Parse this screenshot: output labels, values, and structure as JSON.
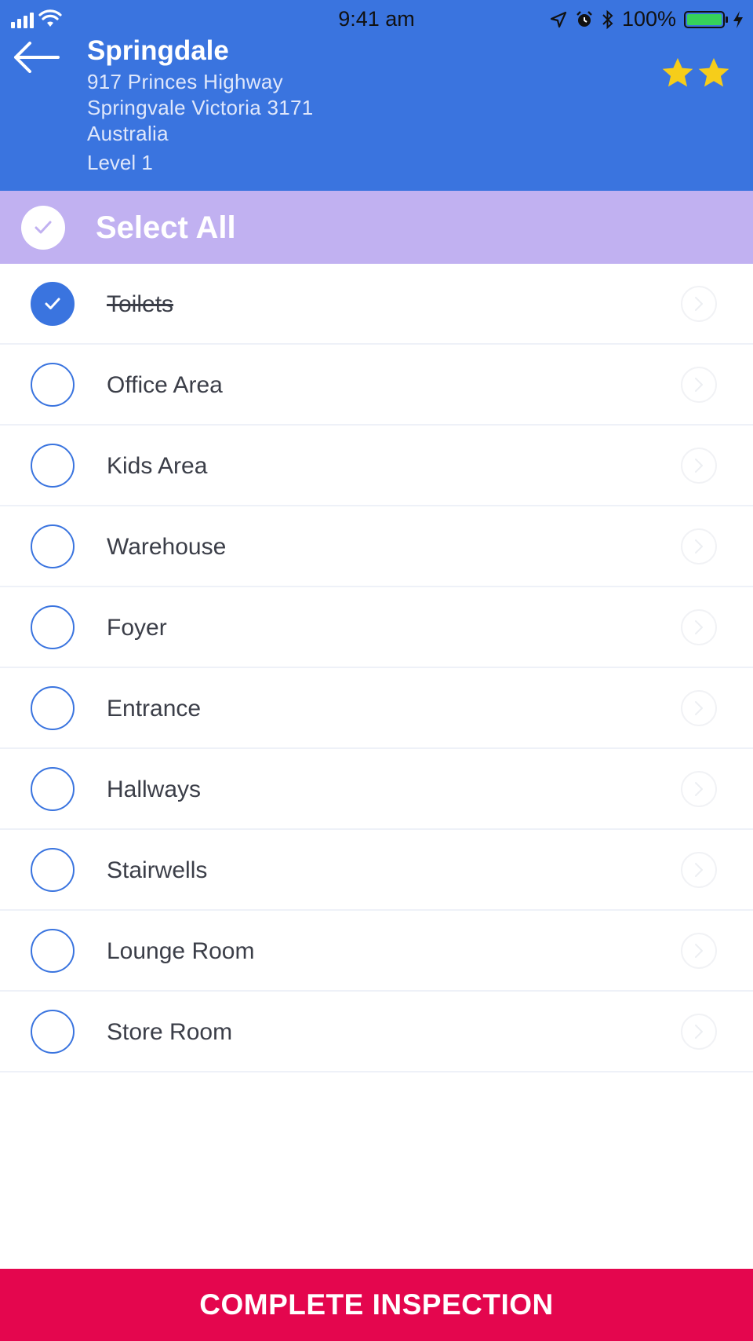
{
  "status_bar": {
    "time": "9:41 am",
    "battery": "100%",
    "icons": [
      "signal-icon",
      "wifi-icon",
      "location-arrow-icon",
      "alarm-icon",
      "bluetooth-icon",
      "battery-icon",
      "charging-bolt-icon"
    ]
  },
  "header": {
    "title": "Springdale",
    "address_line1": "917 Princes Highway",
    "address_line2": "Springvale Victoria 3171",
    "address_line3": "Australia",
    "level": "Level 1",
    "rating_stars": 2,
    "colors": {
      "background": "#3a74df",
      "star": "#f6cd1a"
    }
  },
  "select_all": {
    "label": "Select All",
    "background": "#c1b1f1"
  },
  "areas": [
    {
      "label": "Toilets",
      "checked": true
    },
    {
      "label": "Office Area",
      "checked": false
    },
    {
      "label": "Kids Area",
      "checked": false
    },
    {
      "label": "Warehouse",
      "checked": false
    },
    {
      "label": "Foyer",
      "checked": false
    },
    {
      "label": "Entrance",
      "checked": false
    },
    {
      "label": "Hallways",
      "checked": false
    },
    {
      "label": "Stairwells",
      "checked": false
    },
    {
      "label": "Lounge Room",
      "checked": false
    },
    {
      "label": "Store Room",
      "checked": false
    }
  ],
  "footer": {
    "complete_label": "COMPLETE INSPECTION",
    "background": "#e4064e"
  }
}
